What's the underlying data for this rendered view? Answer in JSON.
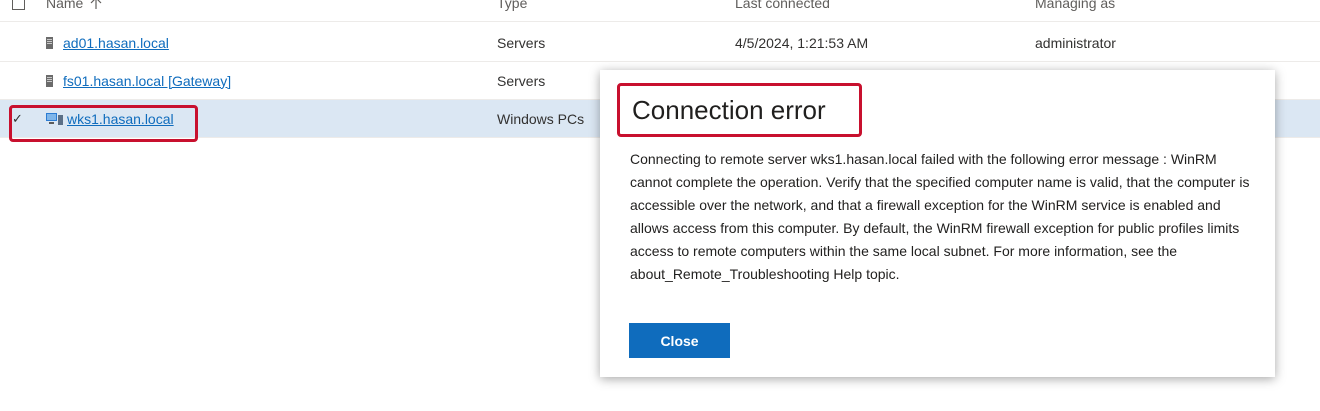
{
  "table": {
    "columns": {
      "name": "Name",
      "type": "Type",
      "last_connected": "Last connected",
      "managing_as": "Managing as"
    },
    "rows": [
      {
        "name": "ad01.hasan.local",
        "type": "Servers",
        "last_connected": "4/5/2024, 1:21:53 AM",
        "managing_as": "administrator",
        "icon": "server-icon",
        "selected": false
      },
      {
        "name": "fs01.hasan.local [Gateway]",
        "type": "Servers",
        "last_connected": "",
        "managing_as": "",
        "icon": "server-icon",
        "selected": false
      },
      {
        "name": "wks1.hasan.local",
        "type": "Windows PCs",
        "last_connected": "",
        "managing_as": "",
        "icon": "pc-icon",
        "selected": true
      }
    ]
  },
  "dialog": {
    "title": "Connection error",
    "message": "Connecting to remote server wks1.hasan.local failed with the following error message : WinRM cannot complete the operation. Verify that the specified computer name is valid, that the computer is accessible over the network, and that a firewall exception for the WinRM service is enabled and allows access from this computer. By default, the WinRM firewall exception for public profiles limits access to remote computers within the same local subnet. For more information, see the about_Remote_Troubleshooting Help topic.",
    "close_label": "Close"
  },
  "colors": {
    "accent": "#0f6cbd",
    "highlight": "#c8102e",
    "selected_row": "#dbe7f3"
  }
}
